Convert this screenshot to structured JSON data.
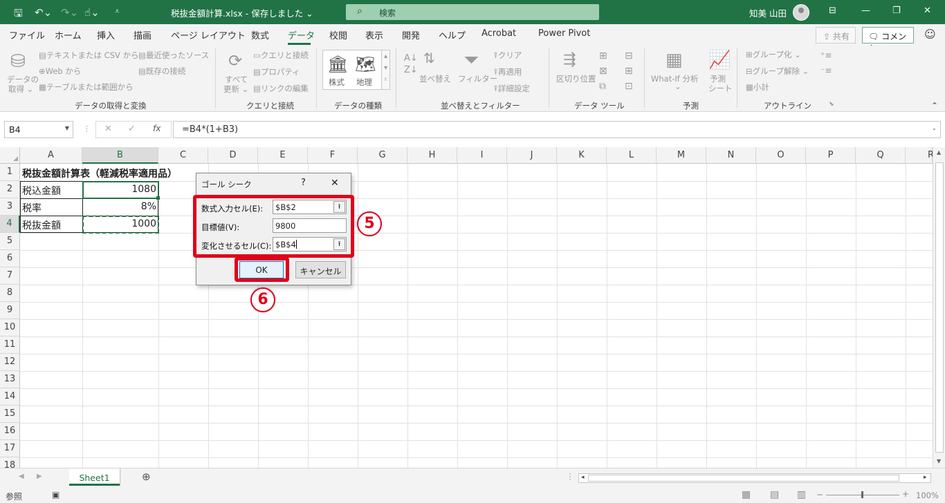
{
  "titlebar": {
    "doc_title": "税抜金額計算.xlsx  -  保存しました  ⌄",
    "search_placeholder": "検索",
    "user_name": "知美 山田"
  },
  "menu": {
    "tabs": [
      "ファイル",
      "ホーム",
      "挿入",
      "描画",
      "ページ レイアウト",
      "数式",
      "データ",
      "校閲",
      "表示",
      "開発",
      "ヘルプ",
      "Acrobat",
      "Power Pivot"
    ],
    "active_tab": "データ",
    "share_label": "共有",
    "comment_label": "コメント"
  },
  "ribbon": {
    "get_data": {
      "big_button": [
        "データの",
        "取得 ⌄"
      ],
      "items": [
        "テキストまたは CSV から",
        "Web から",
        "テーブルまたは範囲から",
        "最近使ったソース",
        "既存の接続"
      ],
      "label": "データの取得と変換"
    },
    "queries": {
      "big_button": [
        "すべて",
        "更新 ⌄"
      ],
      "items": [
        "クエリと接続",
        "プロパティ",
        "リンクの編集"
      ],
      "label": "クエリと接続"
    },
    "data_types": {
      "items": [
        "株式",
        "地理"
      ],
      "label": "データの種類"
    },
    "sort_filter": {
      "items": [
        "並べ替え",
        "フィルター",
        "クリア",
        "再適用",
        "詳細設定"
      ],
      "label": "並べ替えとフィルター"
    },
    "data_tools": {
      "items": [
        "区切り位置"
      ],
      "label": "データ ツール"
    },
    "forecast": {
      "items": [
        "What-If 分析",
        "予測",
        "シート"
      ],
      "label": "予測"
    },
    "outline": {
      "items": [
        "グループ化",
        "グループ解除",
        "小計"
      ],
      "label": "アウトライン"
    }
  },
  "formula_bar": {
    "name_box": "B4",
    "formula": "=B4*(1+B3)"
  },
  "sheet": {
    "columns": [
      "A",
      "B",
      "C",
      "D",
      "E",
      "F",
      "G",
      "H",
      "I",
      "J",
      "K",
      "L",
      "M",
      "N",
      "O",
      "P",
      "Q",
      "R"
    ],
    "rows": [
      "1",
      "2",
      "3",
      "4",
      "5",
      "6",
      "7",
      "8",
      "9",
      "10",
      "11",
      "12",
      "13",
      "14",
      "15",
      "16",
      "17",
      "18"
    ],
    "cells": {
      "A1": "税抜金額計算表（軽減税率適用品）",
      "A2": "税込金額",
      "B2": "1080",
      "A3": "税率",
      "B3": "8%",
      "A4": "税抜金額",
      "B4": "1000"
    }
  },
  "dialog": {
    "title": "ゴール シーク",
    "help": "?",
    "close": "✕",
    "set_cell_label": "数式入力セル(E):",
    "set_cell_value": "$B$2",
    "to_value_label": "目標値(V):",
    "to_value_value": "9800",
    "changing_cell_label": "変化させるセル(C):",
    "changing_cell_value": "$B$4",
    "ok_label": "OK",
    "cancel_label": "キャンセル"
  },
  "annotations": {
    "step5": "5",
    "step6": "6",
    "color": "#e0001b"
  },
  "sheet_tabs": {
    "active": "Sheet1"
  },
  "status": {
    "mode": "参照",
    "zoom": "100%"
  },
  "colors": {
    "excel_green": "#217346"
  }
}
